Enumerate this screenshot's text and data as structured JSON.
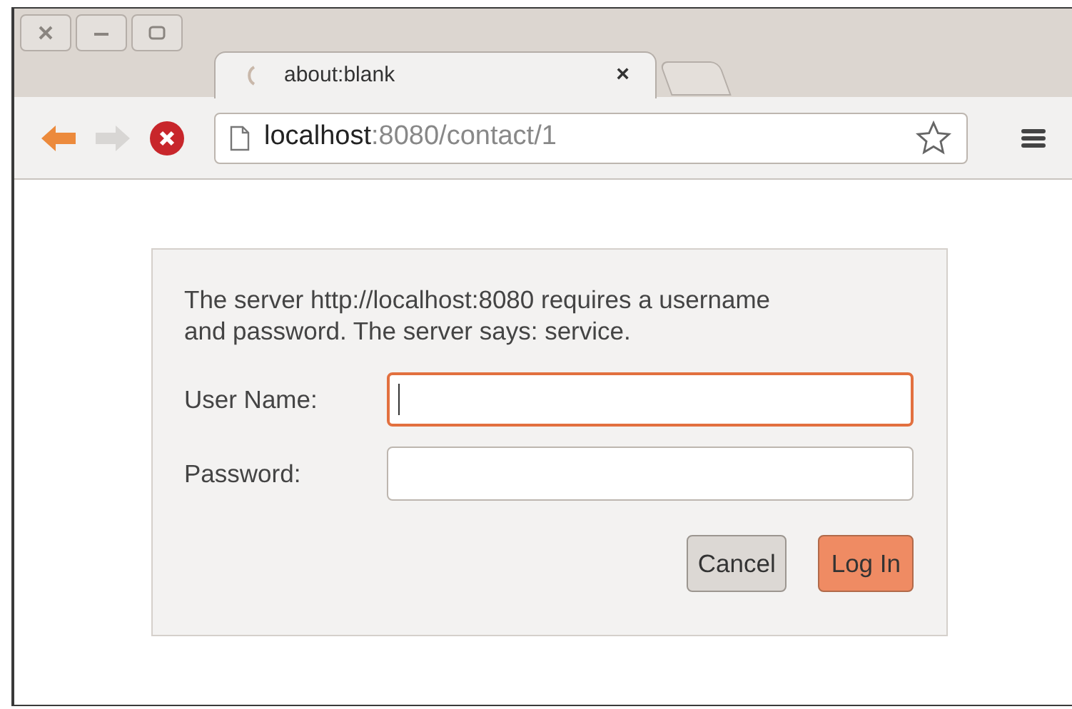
{
  "tab": {
    "title": "about:blank",
    "close": "×"
  },
  "address_bar": {
    "host": "localhost",
    "rest": ":8080/contact/1"
  },
  "dialog": {
    "message": "The server http://localhost:8080 requires a username and password. The server says: service.",
    "fields": [
      {
        "label": "User Name:",
        "focused": true
      },
      {
        "label": "Password:",
        "focused": false
      }
    ],
    "buttons": [
      {
        "label": "Cancel",
        "kind": "secondary"
      },
      {
        "label": "Log In",
        "kind": "primary"
      }
    ]
  }
}
